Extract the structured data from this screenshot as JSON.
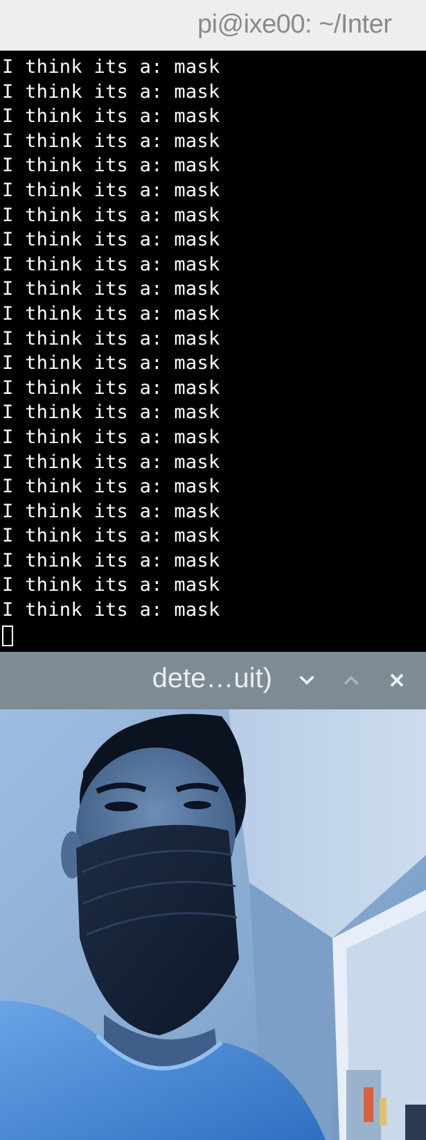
{
  "terminal": {
    "title": "pi@ixe00: ~/Inter",
    "lines": [
      "I think its a: mask",
      "I think its a: mask",
      "I think its a: mask",
      "I think its a: mask",
      "I think its a: mask",
      "I think its a: mask",
      "I think its a: mask",
      "I think its a: mask",
      "I think its a: mask",
      "I think its a: mask",
      "I think its a: mask",
      "I think its a: mask",
      "I think its a: mask",
      "I think its a: mask",
      "I think its a: mask",
      "I think its a: mask",
      "I think its a: mask",
      "I think its a: mask",
      "I think its a: mask",
      "I think its a: mask",
      "I think its a: mask",
      "I think its a: mask",
      "I think its a: mask"
    ]
  },
  "detector_window": {
    "title": "dete…uit)",
    "buttons": {
      "minimize": "chevron-down-icon",
      "maximize": "chevron-up-icon",
      "close": "close-icon"
    }
  },
  "colors": {
    "terminal_bg": "#000000",
    "terminal_fg": "#ffffff",
    "titlebar_active": "#eeeeee",
    "titlebar_detector": "#7e8b94"
  }
}
